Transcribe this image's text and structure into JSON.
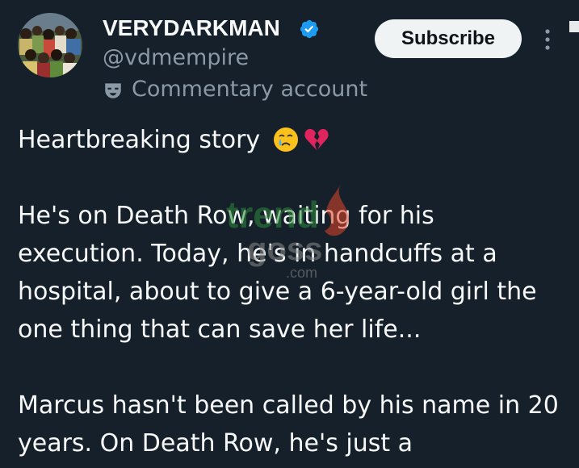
{
  "author": {
    "display_name": "VERYDARKMAN",
    "handle": "@vdmempire",
    "affiliation": "Commentary account",
    "avatar_icon": "crowd-photo-avatar",
    "verified_icon": "verified-badge-icon",
    "verified_color": "#1d9bf0"
  },
  "actions": {
    "subscribe_label": "Subscribe",
    "more_icon": "more-vertical-icon"
  },
  "tweet": {
    "line1": "Heartbreaking story",
    "emoji": [
      "crying-face-emoji",
      "broken-heart-emoji"
    ],
    "paragraph2": "He's on Death Row, waiting for his execution. Today, he's in handcuffs at a hospital, about to give a 6-year-old girl the one thing that can save her life...",
    "paragraph3": "Marcus hasn't been called by his name in 20 years. On Death Row, he's just a"
  },
  "watermark": {
    "line1": "trend",
    "line2": "goss",
    "line3": ".com",
    "icon": "flame-icon"
  },
  "colors": {
    "background": "#15202b",
    "text_primary": "#f7f9f9",
    "text_secondary": "#8b98a5",
    "button_bg": "#eff3f4"
  }
}
